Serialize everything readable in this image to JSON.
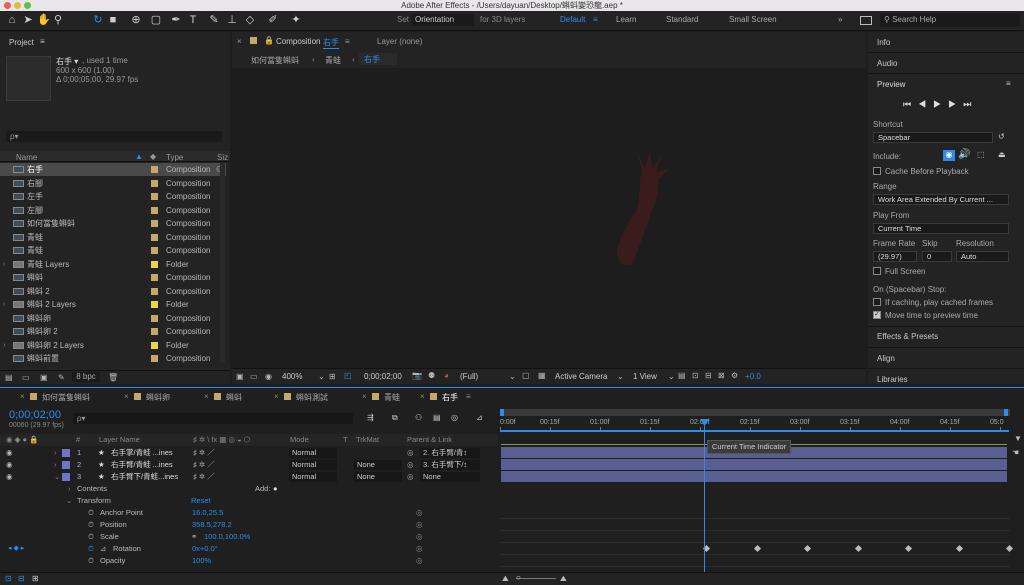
{
  "window": {
    "title": "Adobe After Effects - /Users/dayuan/Desktop/蝌蚪變恐龍.aep *"
  },
  "toolbar": {
    "set_label": "Set",
    "orientation_value": "Orientation",
    "for3d_label": "for 3D layers",
    "workspaces": [
      "Default",
      "Learn",
      "Standard",
      "Small Screen"
    ],
    "search_placeholder": "Search Help"
  },
  "project": {
    "title": "Project",
    "item_name": "右手 ▾",
    "used": ", used 1 time",
    "dims": "600 x 600 (1.00)",
    "duration": "Δ 0;00;05;00, 29.97 fps",
    "search_placeholder": "ρ▾",
    "columns": {
      "name": "Name",
      "type": "Type",
      "size": "Siz"
    },
    "items": [
      {
        "name": "右手",
        "type": "Composition",
        "kind": "comp",
        "color": "#c4a96b",
        "selected": true
      },
      {
        "name": "右腳",
        "type": "Composition",
        "kind": "comp",
        "color": "#c4a96b"
      },
      {
        "name": "左手",
        "type": "Composition",
        "kind": "comp",
        "color": "#c4a96b"
      },
      {
        "name": "左腳",
        "type": "Composition",
        "kind": "comp",
        "color": "#c4a96b"
      },
      {
        "name": "如何當隻蝌蚪",
        "type": "Composition",
        "kind": "comp",
        "color": "#c4a96b"
      },
      {
        "name": "青蛙",
        "type": "Composition",
        "kind": "comp",
        "color": "#c4a96b"
      },
      {
        "name": "青蛙",
        "type": "Composition",
        "kind": "comp",
        "color": "#c4a96b"
      },
      {
        "name": "青蛙 Layers",
        "type": "Folder",
        "kind": "folder",
        "color": "#e8d44d"
      },
      {
        "name": "蝌蚪",
        "type": "Composition",
        "kind": "comp",
        "color": "#c4a96b"
      },
      {
        "name": "蝌蚪 2",
        "type": "Composition",
        "kind": "comp",
        "color": "#c4a96b"
      },
      {
        "name": "蝌蚪 2 Layers",
        "type": "Folder",
        "kind": "folder",
        "color": "#e8d44d"
      },
      {
        "name": "蝌蚪卵",
        "type": "Composition",
        "kind": "comp",
        "color": "#c4a96b"
      },
      {
        "name": "蝌蚪卵 2",
        "type": "Composition",
        "kind": "comp",
        "color": "#c4a96b"
      },
      {
        "name": "蝌蚪卵 2 Layers",
        "type": "Folder",
        "kind": "folder",
        "color": "#e8d44d"
      },
      {
        "name": "蝌蚪前置",
        "type": "Composition",
        "kind": "comp",
        "color": "#c4a96b"
      }
    ],
    "bpc": "8 bpc"
  },
  "comp_panel": {
    "tab_label": "Composition",
    "tab_name": "右手",
    "layer_tab": "Layer (none)",
    "breadcrumbs": [
      "如何當隻蝌蚪",
      "青蛙",
      "右手"
    ],
    "zoom": "400%",
    "timecode": "0;00;02;00",
    "resolution": "(Full)",
    "camera": "Active Camera",
    "view": "1 View",
    "exposure": "+0.0"
  },
  "right_panel": {
    "info": "Info",
    "audio": "Audio",
    "preview": "Preview",
    "shortcut_label": "Shortcut",
    "shortcut_value": "Spacebar",
    "include_label": "Include:",
    "cache_label": "Cache Before Playback",
    "range_label": "Range",
    "range_value": "Work Area Extended By Current ...",
    "play_from_label": "Play From",
    "play_from_value": "Current Time",
    "frame_rate_label": "Frame Rate",
    "frame_rate_value": "(29.97)",
    "skip_label": "Skip",
    "skip_value": "0",
    "resolution_label": "Resolution",
    "resolution_value": "Auto",
    "full_screen_label": "Full Screen",
    "stop_label": "On (Spacebar) Stop:",
    "if_caching_label": "If caching, play cached frames",
    "move_time_label": "Move time to preview time",
    "effects": "Effects & Presets",
    "align": "Align",
    "libraries": "Libraries"
  },
  "timeline": {
    "tabs": [
      "如何當隻蝌蚪",
      "蝌蚪卵",
      "蝌蚪",
      "蝌蚪測試",
      "青蛙",
      "右手"
    ],
    "timecode": "0;00;02;00",
    "frames": "00060 (29.97 fps)",
    "search_placeholder": "ρ▾",
    "cols": {
      "num": "#",
      "layer_name": "Layer Name",
      "mode": "Mode",
      "t": "T",
      "trkmat": "TrkMat",
      "parent": "Parent & Link"
    },
    "layers": [
      {
        "num": "1",
        "name": "右手掌/青蛙 ...ines",
        "mode": "Normal",
        "trkmat": "",
        "parent": "2. 右手臂/青↕",
        "color": "#7074c4"
      },
      {
        "num": "2",
        "name": "右手臂/青蛙 ...ines",
        "mode": "Normal",
        "trkmat": "None",
        "parent": "3. 右手臂下/↕",
        "color": "#7074c4"
      },
      {
        "num": "3",
        "name": "右手臂下/青蛙...ines",
        "mode": "Normal",
        "trkmat": "None",
        "parent": "None",
        "color": "#7074c4"
      }
    ],
    "contents": "Contents",
    "add": "Add:",
    "transform": "Transform",
    "reset": "Reset",
    "props": [
      {
        "name": "Anchor Point",
        "value": "16.0,25.5"
      },
      {
        "name": "Position",
        "value": "358.5,278.2"
      },
      {
        "name": "Scale",
        "value": "100.0,100.0%"
      },
      {
        "name": "Rotation",
        "value": "0x+0.0°"
      },
      {
        "name": "Opacity",
        "value": "100%"
      }
    ],
    "ruler": [
      "0:00f",
      "00:15f",
      "01:00f",
      "01:15f",
      "02:00f",
      "02:15f",
      "03:00f",
      "03:15f",
      "04:00f",
      "04:15f",
      "05:0"
    ],
    "cti_tooltip": "Current Time Indicator",
    "rotation_keyframes_s": [
      2,
      2.5,
      3,
      3.5,
      4,
      4.5,
      5
    ]
  },
  "colors": {
    "accent": "#2d8ceb",
    "layer_bar": "#5a5f91",
    "label": "#7074c4"
  }
}
